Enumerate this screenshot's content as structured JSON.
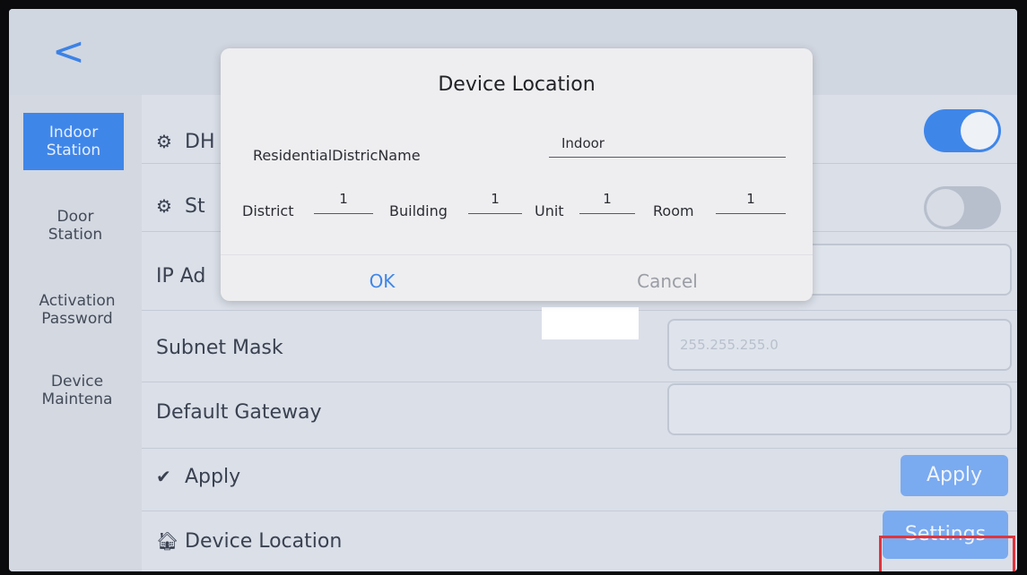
{
  "header": {
    "back_glyph": "<"
  },
  "sidebar": {
    "items": [
      {
        "label": "Indoor Station"
      },
      {
        "label": "Door Station"
      },
      {
        "label": "Activation Password"
      },
      {
        "label": "Device Maintena"
      }
    ]
  },
  "settings": {
    "dhcp_label": "DH",
    "static_label": "St",
    "ip_label": "IP Ad",
    "subnet_label": "Subnet Mask",
    "subnet_value": "255.255.255.0",
    "gateway_label": "Default Gateway",
    "apply_label": "Apply",
    "apply_button": "Apply",
    "location_label": "Device Location",
    "settings_button": "Settings",
    "dhcp_on": true,
    "static_on": false
  },
  "dialog": {
    "title": "Device Location",
    "residential_label": "ResidentialDistricName",
    "residential_value": "Indoor",
    "district_label": "District",
    "district_value": "1",
    "building_label": "Building",
    "building_value": "1",
    "unit_label": "Unit",
    "unit_value": "1",
    "room_label": "Room",
    "room_value": "1",
    "ok_label": "OK",
    "cancel_label": "Cancel"
  },
  "colors": {
    "accent": "#3f86e9",
    "highlight": "#e0343c"
  }
}
